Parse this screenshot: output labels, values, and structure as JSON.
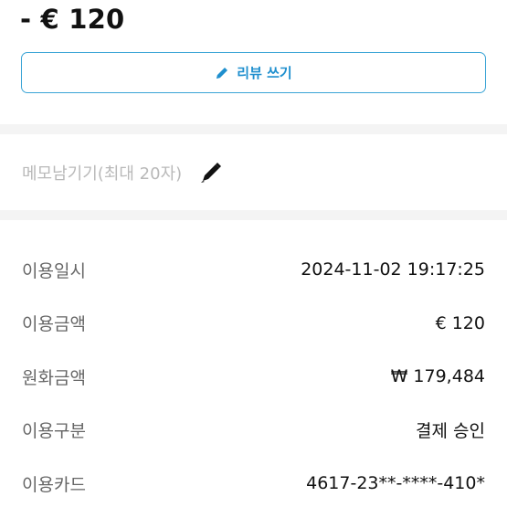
{
  "header": {
    "amount": "- € 120"
  },
  "review_button": {
    "label": "리뷰 쓰기",
    "icon": "pencil-icon",
    "color": "#1f8fce"
  },
  "memo": {
    "placeholder": "메모남기기(최대 20자)",
    "icon": "pen-icon"
  },
  "details": [
    {
      "label": "이용일시",
      "value": "2024-11-02 19:17:25"
    },
    {
      "label": "이용금액",
      "value": "€ 120"
    },
    {
      "label": "원화금액",
      "value": "₩ 179,484"
    },
    {
      "label": "이용구분",
      "value": "결제 승인"
    },
    {
      "label": "이용카드",
      "value": "4617-23**-****-410*"
    }
  ]
}
